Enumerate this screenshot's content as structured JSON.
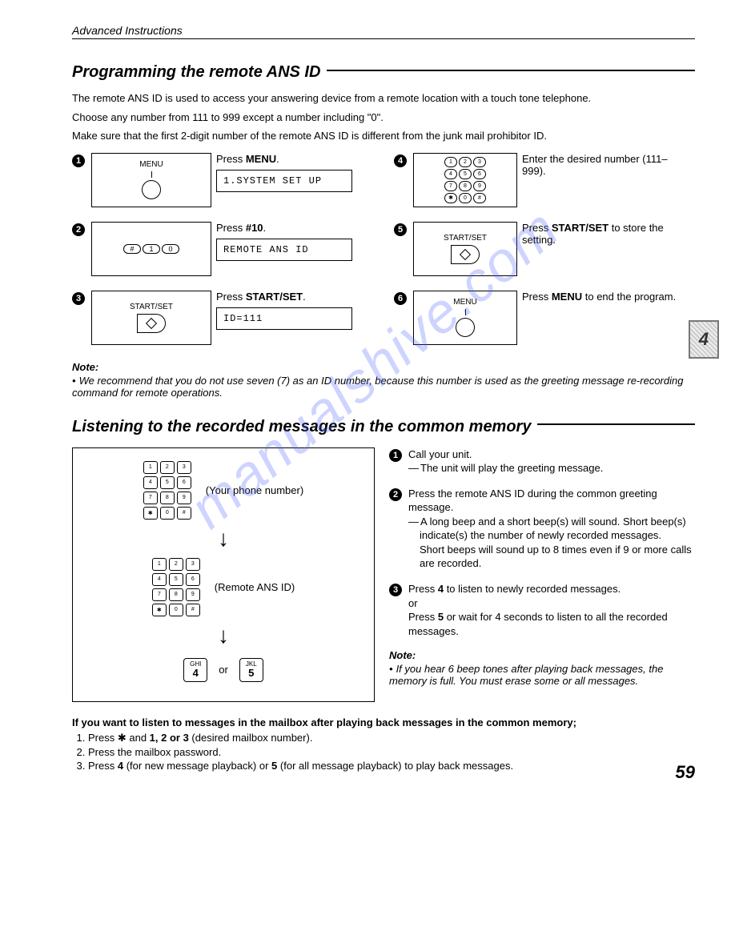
{
  "header": "Advanced Instructions",
  "page_number": "59",
  "side_badge": "4",
  "watermark": "manualshive.com",
  "section1": {
    "title": "Programming the remote ANS ID",
    "intro": [
      "The remote ANS ID is used to access your answering device from a remote location with a touch tone telephone.",
      "Choose any number from 111 to 999 except a number including \"0\".",
      "Make sure that the first 2-digit number of the remote ANS ID is different from the junk mail prohibitor ID."
    ],
    "steps": [
      {
        "n": "1",
        "panel_label": "MENU",
        "instr_prefix": "Press ",
        "instr_bold": "MENU",
        "instr_suffix": ".",
        "lcd": "1.SYSTEM SET UP"
      },
      {
        "n": "2",
        "panel_keys": [
          "#",
          "1",
          "0"
        ],
        "instr_prefix": "Press ",
        "instr_bold": "#10",
        "instr_suffix": ".",
        "lcd": "REMOTE ANS ID"
      },
      {
        "n": "3",
        "panel_label": "START/SET",
        "instr_prefix": "Press ",
        "instr_bold": "START/SET",
        "instr_suffix": ".",
        "lcd": "ID=111"
      },
      {
        "n": "4",
        "panel_type": "keypad",
        "instr": "Enter the desired number (111–999)."
      },
      {
        "n": "5",
        "panel_label": "START/SET",
        "instr_prefix": "Press ",
        "instr_bold": "START/SET",
        "instr_suffix": " to store the setting."
      },
      {
        "n": "6",
        "panel_label": "MENU",
        "instr_prefix": "Press ",
        "instr_bold": "MENU",
        "instr_suffix": " to end the program."
      }
    ],
    "note_title": "Note:",
    "note_body": "We recommend that you do not use seven (7) as an ID number, because this number is used as the greeting message re-recording command for remote operations."
  },
  "section2": {
    "title": "Listening to the recorded messages in the common memory",
    "diagram": {
      "label1": "(Your phone number)",
      "label2": "(Remote ANS ID)",
      "key4_top": "GHI",
      "key4_num": "4",
      "or": "or",
      "key5_top": "JKL",
      "key5_num": "5"
    },
    "rhs": [
      {
        "n": "1",
        "main": "Call your unit.",
        "sub": "The unit will play the greeting message."
      },
      {
        "n": "2",
        "main": "Press the remote ANS ID during the common greeting message.",
        "sub": "A long beep and a short beep(s) will sound. Short beep(s) indicate(s) the number of newly recorded messages.",
        "extra": "Short beeps will sound up to 8 times even if 9 or more calls are recorded."
      },
      {
        "n": "3",
        "main_pre": "Press ",
        "main_b1": "4",
        "main_mid": " to listen to newly recorded messages.",
        "or": "or",
        "alt_pre": "Press ",
        "alt_b": "5",
        "alt_post": " or wait for 4 seconds to listen to all the recorded messages."
      }
    ],
    "note_title": "Note:",
    "note_body": "If you hear 6 beep tones after playing back messages, the memory is full. You must erase some or all messages."
  },
  "mailbox": {
    "title": "If you want to listen to messages in the mailbox after playing back messages in the common memory;",
    "items": [
      {
        "pre": "Press ",
        "sym": "✱",
        "mid": " and ",
        "b": "1, 2 or 3",
        "post": " (desired mailbox number)."
      },
      {
        "text": "Press the mailbox password."
      },
      {
        "pre": "Press ",
        "b1": "4",
        "mid1": " (for new message playback) or ",
        "b2": "5",
        "post": " (for all message playback) to play back messages."
      }
    ]
  }
}
